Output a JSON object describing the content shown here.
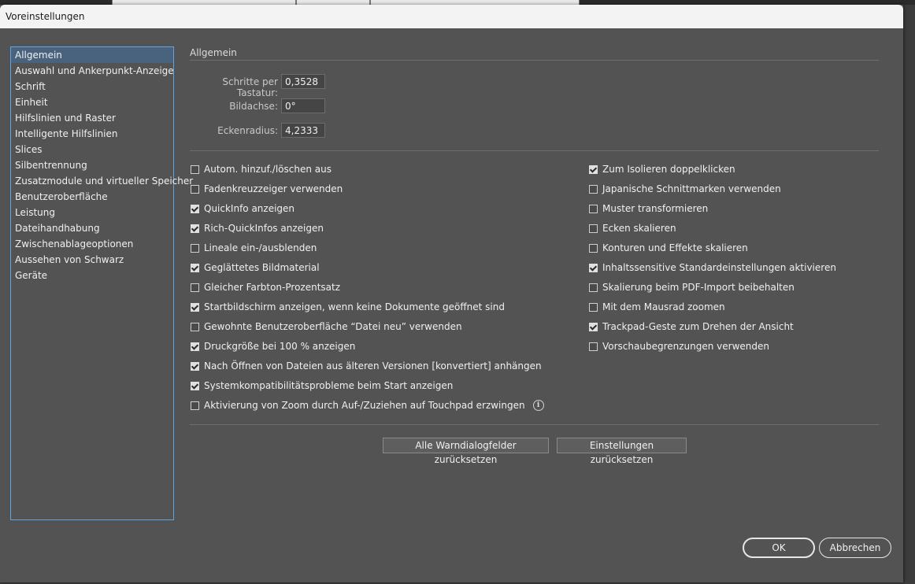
{
  "window": {
    "title": "Voreinstellungen"
  },
  "sidebar": {
    "items": [
      {
        "label": "Allgemein",
        "selected": true
      },
      {
        "label": "Auswahl und Ankerpunkt-Anzeige"
      },
      {
        "label": "Schrift"
      },
      {
        "label": "Einheit"
      },
      {
        "label": "Hilfslinien und Raster"
      },
      {
        "label": "Intelligente Hilfslinien"
      },
      {
        "label": "Slices"
      },
      {
        "label": "Silbentrennung"
      },
      {
        "label": "Zusatzmodule und virtueller Speicher"
      },
      {
        "label": "Benutzeroberfläche"
      },
      {
        "label": "Leistung"
      },
      {
        "label": "Dateihandhabung"
      },
      {
        "label": "Zwischenablageoptionen"
      },
      {
        "label": "Aussehen von Schwarz"
      },
      {
        "label": "Geräte"
      }
    ]
  },
  "main": {
    "section_title": "Allgemein",
    "fields": {
      "keyboard_increment": {
        "label": "Schritte per Tastatur:",
        "value": "0,3528 mm"
      },
      "constrain_angle": {
        "label": "Bildachse:",
        "value": "0°"
      },
      "corner_radius": {
        "label": "Eckenradius:",
        "value": "4,2333 mm"
      }
    },
    "left_options": [
      {
        "label": "Autom. hinzuf./löschen aus",
        "checked": false
      },
      {
        "label": "Fadenkreuzzeiger verwenden",
        "checked": false
      },
      {
        "label": "QuickInfo anzeigen",
        "checked": true
      },
      {
        "label": "Rich-QuickInfos anzeigen",
        "checked": true
      },
      {
        "label": "Lineale ein-/ausblenden",
        "checked": false
      },
      {
        "label": "Geglättetes Bildmaterial",
        "checked": true
      },
      {
        "label": "Gleicher Farbton-Prozentsatz",
        "checked": false
      },
      {
        "label": "Startbildschirm anzeigen, wenn keine Dokumente geöffnet sind",
        "checked": true
      },
      {
        "label": "Gewohnte Benutzeroberfläche “Datei neu” verwenden",
        "checked": false
      },
      {
        "label": "Druckgröße bei 100 % anzeigen",
        "checked": true
      },
      {
        "label": "Nach Öffnen von Dateien aus älteren Versionen [konvertiert] anhängen",
        "checked": true
      },
      {
        "label": "Systemkompatibilitätsprobleme beim Start anzeigen",
        "checked": true
      },
      {
        "label": "Aktivierung von Zoom durch Auf-/Zuziehen auf Touchpad erzwingen",
        "checked": false,
        "info_icon": "info-icon"
      }
    ],
    "right_options": [
      {
        "label": "Zum Isolieren doppelklicken",
        "checked": true
      },
      {
        "label": "Japanische Schnittmarken verwenden",
        "checked": false
      },
      {
        "label": "Muster transformieren",
        "checked": false
      },
      {
        "label": "Ecken skalieren",
        "checked": false
      },
      {
        "label": "Konturen und Effekte skalieren",
        "checked": false
      },
      {
        "label": "Inhaltssensitive Standardeinstellungen aktivieren",
        "checked": true
      },
      {
        "label": "Skalierung beim PDF-Import beibehalten",
        "checked": false
      },
      {
        "label": "Mit dem Mausrad zoomen",
        "checked": false
      },
      {
        "label": "Trackpad-Geste zum Drehen der Ansicht",
        "checked": true
      },
      {
        "label": "Vorschaubegrenzungen verwenden",
        "checked": false
      }
    ],
    "reset_warnings_label": "Alle Warndialogfelder zurücksetzen",
    "reset_settings_label": "Einstellungen zurücksetzen"
  },
  "footer": {
    "ok_label": "OK",
    "cancel_label": "Abbrechen"
  },
  "colors": {
    "dialog_bg": "#535353",
    "selection": "#49637f",
    "focus_border": "#5fa3e3"
  }
}
